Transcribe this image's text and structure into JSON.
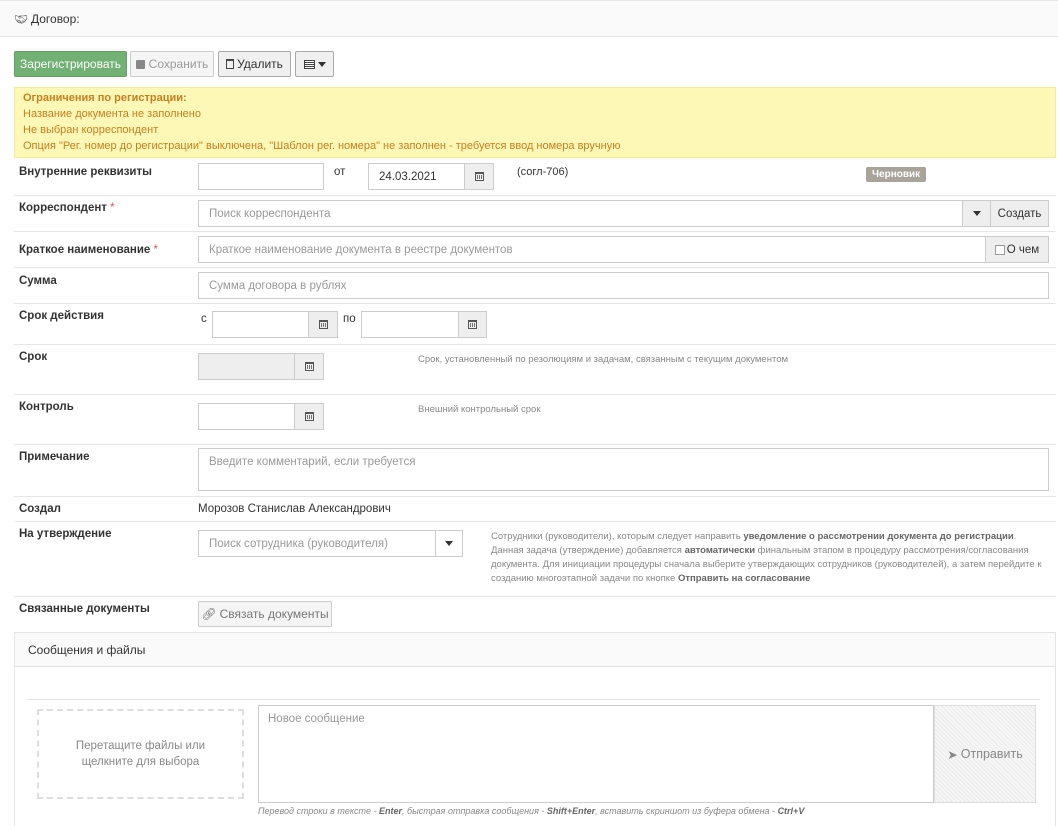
{
  "header": {
    "title": "Договор:",
    "icon": "handshake-icon"
  },
  "toolbar": {
    "register_label": "Зарегистрировать",
    "save_label": "Сохранить",
    "delete_label": "Удалить",
    "menu_icon": "list-icon"
  },
  "alert": {
    "title": "Ограничения по регистрации:",
    "lines": [
      "Название документа не заполнено",
      "Не выбран корреспондент",
      "Опция \"Рег. номер до регистрации\" выключена, \"Шаблон рег. номера\" не заполнен - требуется ввод номера вручную"
    ]
  },
  "form": {
    "internal": {
      "label": "Внутренние реквизиты",
      "number_value": "",
      "from_label": "от",
      "date_value": "24.03.2021",
      "ref": "(согл-706)",
      "status": "Черновик"
    },
    "correspondent": {
      "label": "Корреспондент",
      "required": "*",
      "placeholder": "Поиск корреспондента",
      "create_label": "Создать"
    },
    "short_name": {
      "label": "Краткое наименование",
      "required": "*",
      "placeholder": "Краткое наименование документа в реестре документов",
      "about_label": "О чем"
    },
    "amount": {
      "label": "Сумма",
      "placeholder": "Сумма договора в рублях"
    },
    "validity": {
      "label": "Срок действия",
      "from_label": "с",
      "to_label": "по"
    },
    "deadline": {
      "label": "Срок",
      "hint": "Срок, установленный по резолюциям и задачам, связанным с текущим документом"
    },
    "control": {
      "label": "Контроль",
      "hint": "Внешний контрольный срок"
    },
    "note": {
      "label": "Примечание",
      "placeholder": "Введите комментарий, если требуется"
    },
    "created_by": {
      "label": "Создал",
      "value": "Морозов Станислав Александрович"
    },
    "approval": {
      "label": "На утверждение",
      "placeholder": "Поиск сотрудника (руководителя)",
      "hint_parts": [
        "Сотрудники (руководители), которым следует направить ",
        "уведомление о рассмотрении документа до ",
        "регистрации",
        ". Данная задача (утверждение) добавляется ",
        "автоматически",
        " финальным этапом в процедуру рассмотрения/согласования документа. Для инициации процедуры сначала выберите утверждающих сотрудников (руководителей), а затем перейдите к созданию многоэтапной задачи по кнопке ",
        "Отправить на согласование"
      ]
    },
    "related": {
      "label": "Связанные документы",
      "button_label": "Связать документы"
    }
  },
  "messages": {
    "title": "Сообщения и файлы",
    "dropzone": "Перетащите файлы или щелкните для выбора",
    "placeholder": "Новое сообщение",
    "send_label": "Отправить",
    "hint_parts": [
      "Перевод строки в тексте - ",
      "Enter",
      ", быстрая отправка сообщения - ",
      "Shift+Enter",
      ", вставить скриншот из буфера обмена - ",
      "Ctrl+V"
    ]
  }
}
